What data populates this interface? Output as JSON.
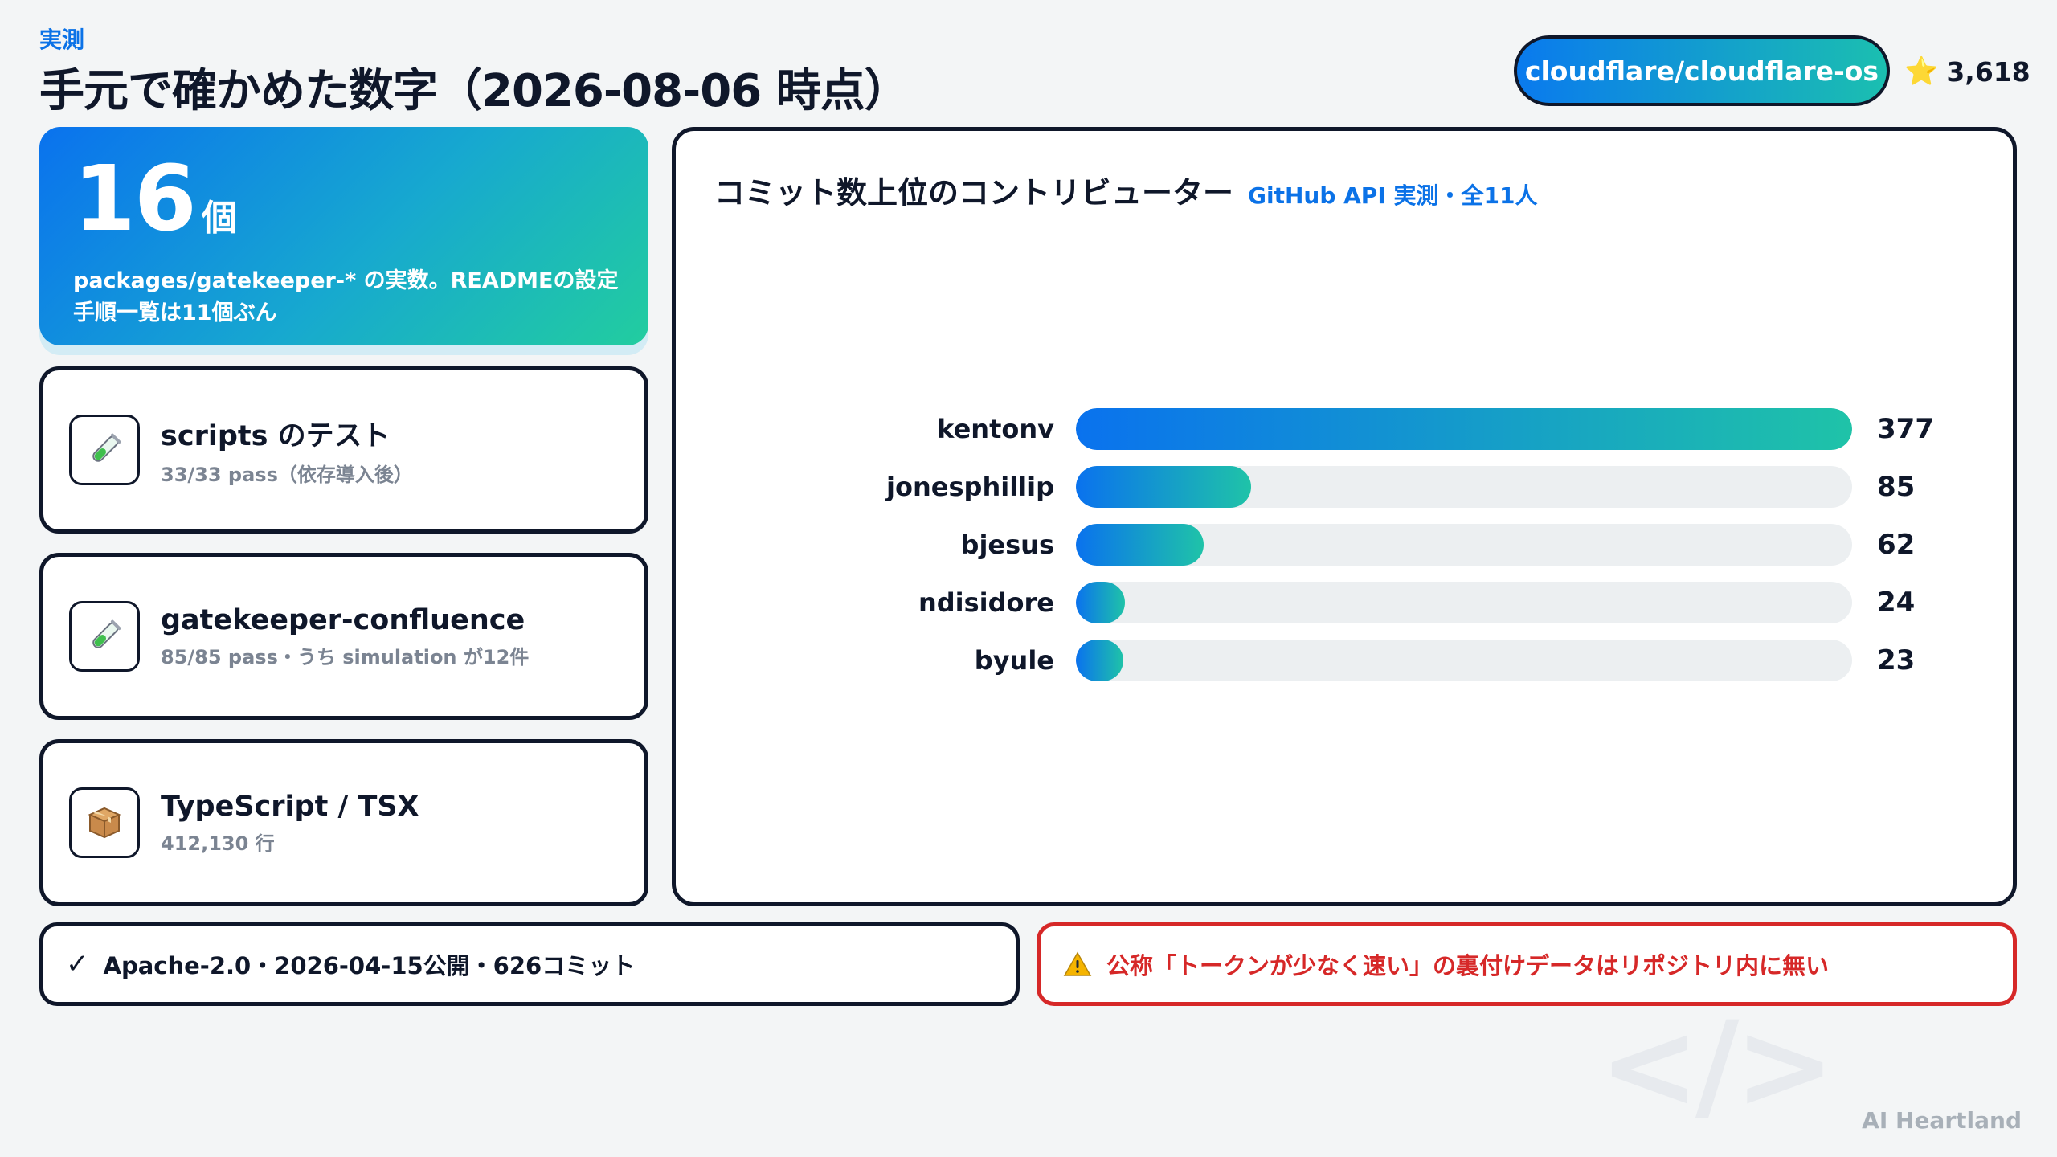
{
  "header": {
    "label": "実測",
    "title": "手元で確かめた数字（2026-08-06 時点）",
    "repo": "cloudflare/cloudflare-os",
    "stars": "3,618",
    "star_icon": "star-icon"
  },
  "hero": {
    "value": "16",
    "unit": "個",
    "description": "packages/gatekeeper-* の実数。READMEの設定手順一覧は11個ぶん"
  },
  "stats": [
    {
      "icon": "test-tube-icon",
      "title": "scripts のテスト",
      "sub": "33/33 pass（依存導入後）"
    },
    {
      "icon": "test-tube-icon",
      "title": "gatekeeper-confluence",
      "sub": "85/85 pass・うち simulation が12件"
    },
    {
      "icon": "package-icon",
      "title": "TypeScript / TSX",
      "sub": "412,130 行"
    }
  ],
  "chart_data": {
    "type": "bar",
    "orientation": "horizontal",
    "title": "コミット数上位のコントリビューター",
    "subtitle": "GitHub API 実測・全11人",
    "categories": [
      "kentonv",
      "jonesphillip",
      "bjesus",
      "ndisidore",
      "byule"
    ],
    "values": [
      377,
      85,
      62,
      24,
      23
    ],
    "xlim": [
      0,
      377
    ],
    "colors": {
      "bar_start": "#0a72ee",
      "bar_end": "#1fc3a8",
      "track": "#eceff1"
    }
  },
  "footer": {
    "left": "Apache-2.0・2026-04-15公開・626コミット",
    "right": "公称「トークンが少なく速い」の裏付けデータはリポジトリ内に無い"
  },
  "brand": "AI Heartland",
  "colors": {
    "accent": "#0b72e7",
    "gradient_start": "#0a72ee",
    "gradient_end": "#22cd9f",
    "warning": "#d62828",
    "background": "#f3f5f6"
  }
}
